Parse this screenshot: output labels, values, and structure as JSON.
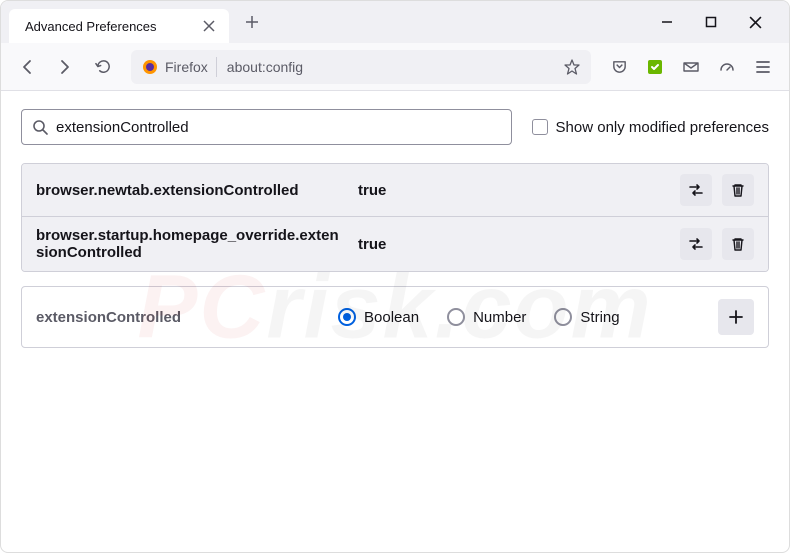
{
  "window": {
    "tab_title": "Advanced Preferences"
  },
  "toolbar": {
    "identity_label": "Firefox",
    "url": "about:config"
  },
  "search": {
    "value": "extensionControlled",
    "checkbox_label": "Show only modified preferences"
  },
  "prefs": [
    {
      "name": "browser.newtab.extensionControlled",
      "value": "true"
    },
    {
      "name": "browser.startup.homepage_override.extensionControlled",
      "value": "true"
    }
  ],
  "new_pref": {
    "name": "extensionControlled",
    "types": [
      "Boolean",
      "Number",
      "String"
    ],
    "selected": "Boolean"
  }
}
